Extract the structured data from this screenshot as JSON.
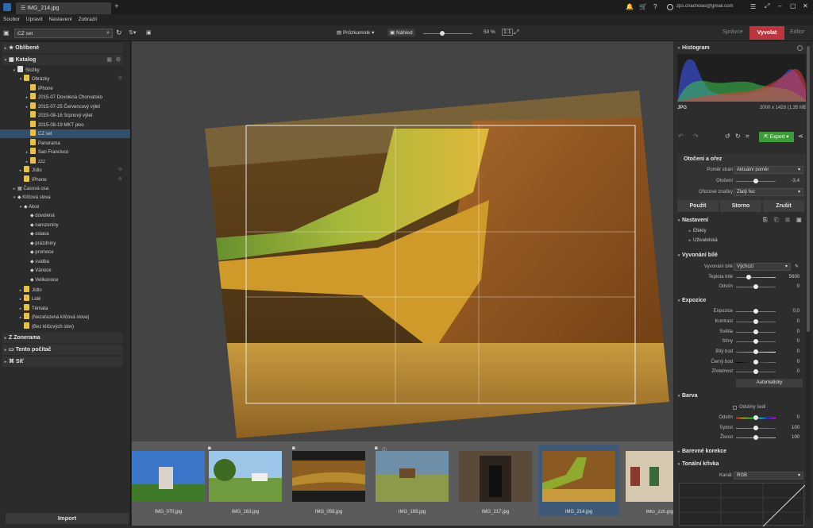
{
  "title_bar": {
    "tab_title": "IMG_214.jpg",
    "new_tab": "+",
    "user_email": "zps.cnacholas@gmail.com"
  },
  "menu": [
    "Soubor",
    "Upravit",
    "Nastavení",
    "Zobrazit"
  ],
  "toolbar": {
    "search_value": "CZ set",
    "view_mode": "Průzkumník",
    "preview_label": "Náhled",
    "zoom": "50 %",
    "modes": {
      "manager": "Správce",
      "develop": "Vyvolat",
      "editor": "Editor"
    }
  },
  "left_panel": {
    "favorites": "Oblíbené",
    "catalog": "Katalog",
    "folders": "Složky",
    "pictures": "Obrázky",
    "folder_items": [
      "iPhone",
      "2015-07 Dovolená Chorvatsko",
      "2015-07-25 Červencový výlet",
      "2015-08-16 Srpnový výlet",
      "2015-08-19 MKT pivo",
      "CZ set",
      "Panorama",
      "San Francisco",
      "zzz"
    ],
    "food": "Jídlo",
    "iphone2": "iPhone",
    "timeline": "Časová osa",
    "keywords": "Klíčová slova",
    "actions": "Akce",
    "action_items": [
      "dovolená",
      "narozeniny",
      "oslava",
      "prázdniny",
      "promoce",
      "svatba",
      "Vánoce",
      "Velikonoce"
    ],
    "kw_food": "Jídlo",
    "kw_people": "Lidé",
    "kw_topics": "Témata",
    "kw_unassigned": "(Nezařazená klíčová slova)",
    "kw_none": "(Bez klíčových slov)",
    "zonerama": "Zonerama",
    "this_pc": "Tento počítač",
    "network": "Síť",
    "import": "Import"
  },
  "filmstrip": [
    {
      "name": "IMG_070.jpg"
    },
    {
      "name": "IMG_163.jpg"
    },
    {
      "name": "IMG_056.jpg"
    },
    {
      "name": "IMG_169.jpg"
    },
    {
      "name": "IMG_217.jpg"
    },
    {
      "name": "IMG_214.jpg"
    },
    {
      "name": "IMG_220.jpg"
    }
  ],
  "right_panel": {
    "histogram": {
      "title": "Histogram",
      "format": "JPG",
      "dims": "2000 x 1428 (1,35 MB)"
    },
    "export_label": "Export",
    "rotate_crop": {
      "title": "Otočení a ořez",
      "aspect_label": "Poměr stran",
      "aspect_value": "Aktuální poměr",
      "rotation_label": "Otočení",
      "rotation_value": "-3,4",
      "crop_marks_label": "Ořezové značky",
      "crop_marks_value": "Zlatý řez",
      "apply": "Použít",
      "cancel": "Storno",
      "reset": "Zrušit"
    },
    "settings": {
      "title": "Nastavení",
      "effects": "Efekty",
      "user": "Uživatelská"
    },
    "white_balance": {
      "title": "Vyvonání bílé",
      "wb_label": "Vyvonání bílé",
      "wb_value": "Výchozí",
      "temp_label": "Teplota bílé",
      "temp_value": "5600",
      "tint_label": "Odstín",
      "tint_value": "0"
    },
    "exposure": {
      "title": "Expozice",
      "rows": [
        {
          "label": "Expozice",
          "value": "0,0"
        },
        {
          "label": "Kontrast",
          "value": "0"
        },
        {
          "label": "Světla",
          "value": "0"
        },
        {
          "label": "Stíny",
          "value": "0"
        },
        {
          "label": "Bílý bod",
          "value": "0"
        },
        {
          "label": "Černý bod",
          "value": "0"
        },
        {
          "label": "Zřetelnost",
          "value": "0"
        }
      ],
      "auto": "Automaticky"
    },
    "color": {
      "title": "Barva",
      "grayscale": "Odstíny šedi",
      "rows": [
        {
          "label": "Odstín",
          "value": "0"
        },
        {
          "label": "Sytost",
          "value": "100"
        },
        {
          "label": "Živost",
          "value": "100"
        }
      ]
    },
    "color_correction": "Barevné korekce",
    "tone_curve": {
      "title": "Tonální křivka",
      "channel_label": "Kanál:",
      "channel_value": "RGB"
    }
  },
  "colors": {
    "develop_active": "#c0343b",
    "export_green": "#3f9a3c",
    "selection": "#32506e"
  }
}
